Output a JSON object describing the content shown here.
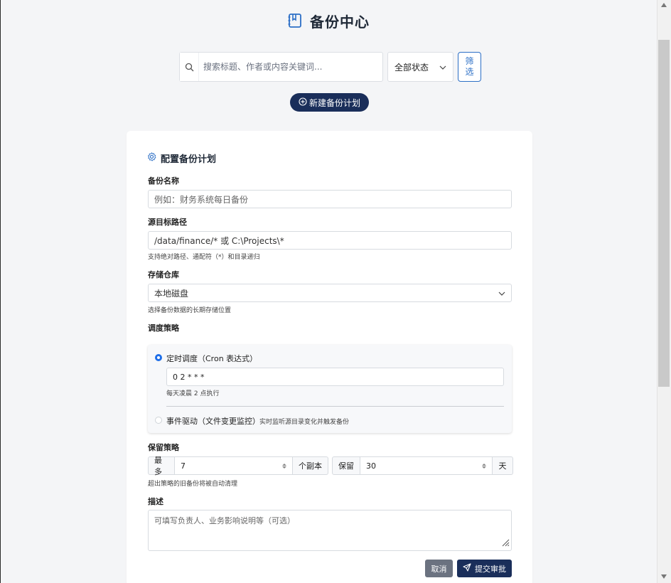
{
  "header": {
    "title": "备份中心",
    "icon": "book-icon"
  },
  "search": {
    "placeholder": "搜索标题、作者或内容关键词...",
    "icon": "search-icon"
  },
  "status_filter": {
    "selected": "全部状态"
  },
  "filter_button": {
    "label": "筛选"
  },
  "new_plan_button": {
    "label": "新建备份计划",
    "icon": "plus-circle-icon"
  },
  "form": {
    "title": "配置备份计划",
    "title_icon": "gear-icon",
    "name": {
      "label": "备份名称",
      "placeholder": "例如：财务系统每日备份"
    },
    "source": {
      "label": "源目标路径",
      "value": "/data/finance/* 或 C:\\Projects\\*",
      "help": "支持绝对路径、通配符（*）和目录递归"
    },
    "repository": {
      "label": "存储仓库",
      "selected": "本地磁盘",
      "help": "选择备份数据的长期存储位置"
    },
    "schedule": {
      "label": "调度策略",
      "timed": {
        "label": "定时调度（Cron 表达式）",
        "cron": "0 2 * * *",
        "help": "每天凌晨 2 点执行",
        "selected": true
      },
      "event": {
        "label": "事件驱动（文件变更监控）",
        "desc": "实时监听源目录变化并触发备份",
        "selected": false
      }
    },
    "retention": {
      "label": "保留策略",
      "max_prefix": "最多",
      "max_value": "7",
      "max_suffix": "个副本",
      "keep_prefix": "保留",
      "keep_value": "30",
      "keep_suffix": "天",
      "help": "超出策略的旧备份将被自动清理"
    },
    "description": {
      "label": "描述",
      "placeholder": "可填写负责人、业务影响说明等（可选）"
    },
    "cancel_label": "取消",
    "submit_label": "提交审批",
    "submit_icon": "send-icon"
  },
  "colors": {
    "primary": "#1a2e5a",
    "accent": "#2c6fc6",
    "radio": "#1e6ee8"
  }
}
